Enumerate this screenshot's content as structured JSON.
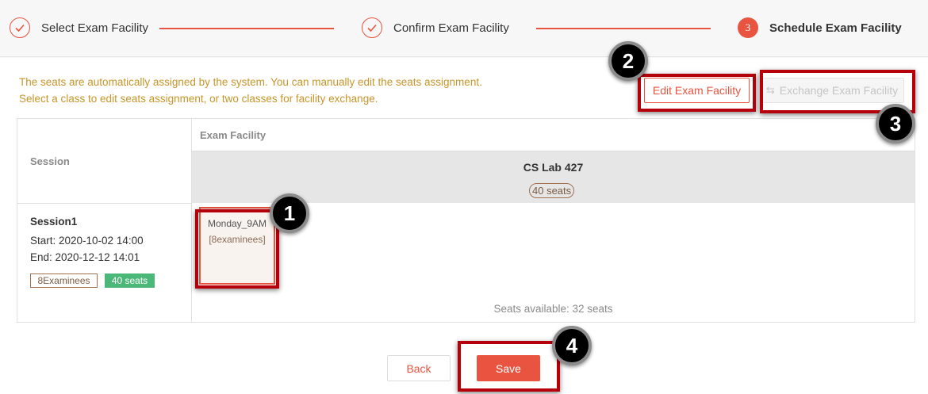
{
  "steps": [
    {
      "label": "Select Exam Facility",
      "state": "done",
      "icon": "check-icon"
    },
    {
      "label": "Confirm Exam Facility",
      "state": "done",
      "icon": "check-icon"
    },
    {
      "label": "Schedule Exam Facility",
      "state": "active",
      "number": "3"
    }
  ],
  "info": {
    "line1": "The seats are automatically assigned by the system. You can manually edit the seats assignment.",
    "line2": "Select a class to edit seats assignment, or two classes for facility exchange."
  },
  "toolbar": {
    "edit_label": "Edit Exam Facility",
    "exchange_label": "Exchange Exam Facility",
    "exchange_icon": "exchange-icon"
  },
  "table": {
    "session_header": "Session",
    "facility_header": "Exam Facility",
    "facility": {
      "name": "CS Lab 427",
      "seats": "40 seats"
    }
  },
  "session": {
    "name": "Session1",
    "start": "Start:  2020-10-02 14:00",
    "end": "End:  2020-12-12 14:01",
    "examinees_tag": "8Examinees",
    "seats_tag": "40 seats"
  },
  "class_card": {
    "name": "Monday_9AM",
    "examinees": "[8examinees]"
  },
  "seats_available": "Seats available: 32 seats",
  "footer": {
    "back_label": "Back",
    "save_label": "Save"
  },
  "callouts": [
    "1",
    "2",
    "3",
    "4"
  ],
  "colors": {
    "accent": "#e8543f",
    "info_text": "#c8952a",
    "seats_tag_bg": "#4bb87a",
    "highlight": "#b5000c"
  }
}
